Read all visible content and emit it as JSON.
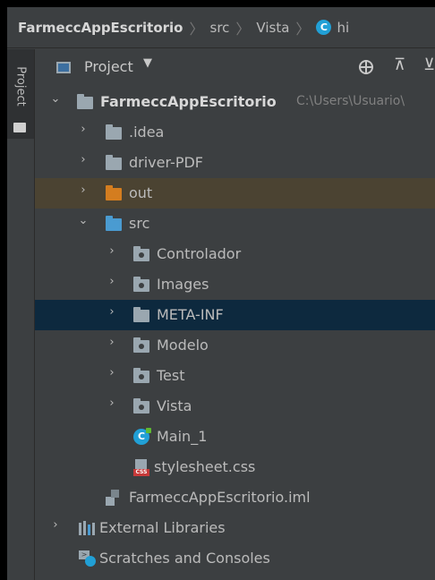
{
  "breadcrumb": {
    "root": "FarmeccAppEscritorio",
    "part2": "src",
    "part3": "Vista",
    "file_icon_letter": "C",
    "file": "hi"
  },
  "side_stripe": {
    "tab_label": "Project"
  },
  "panel": {
    "title": "Project",
    "dropdown_glyph": "▼",
    "collapse_glyph": "⊼",
    "expand_glyph": "⊻"
  },
  "tree": {
    "root": {
      "label": "FarmeccAppEscritorio",
      "path": "C:\\Users\\Usuario\\"
    },
    "idea": {
      "label": ".idea"
    },
    "driver_pdf": {
      "label": "driver-PDF"
    },
    "out": {
      "label": "out"
    },
    "src": {
      "label": "src"
    },
    "controlador": {
      "label": "Controlador"
    },
    "images": {
      "label": "Images"
    },
    "meta_inf": {
      "label": "META-INF"
    },
    "modelo": {
      "label": "Modelo"
    },
    "test": {
      "label": "Test"
    },
    "vista": {
      "label": "Vista"
    },
    "main_1": {
      "label": "Main_1",
      "icon_letter": "C"
    },
    "stylesheet": {
      "label": "stylesheet.css",
      "icon_tag": "CSS"
    },
    "iml": {
      "label": "FarmeccAppEscritorio.iml"
    },
    "external_libraries": {
      "label": "External Libraries"
    },
    "scratches": {
      "label": "Scratches and Consoles"
    }
  },
  "colors": {
    "background": "#3c3f41",
    "selected_row": "#0d293e",
    "excluded_row": "#4b4332",
    "accent_blue": "#21a0d6",
    "excluded_folder": "#d47d1f",
    "source_folder": "#4a9bd1"
  },
  "icons": {
    "chevron_right": "chevron-right-icon",
    "chevron_down": "chevron-down-icon",
    "folder": "folder-icon",
    "package": "package-icon",
    "java_class": "java-class-icon",
    "css_file": "css-file-icon",
    "module_file": "module-file-icon",
    "libraries": "libraries-icon",
    "scratches": "scratches-icon"
  }
}
